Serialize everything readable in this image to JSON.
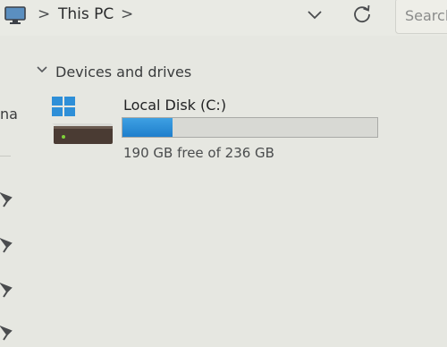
{
  "header": {
    "breadcrumb": {
      "separator": ">",
      "items": [
        "This PC"
      ],
      "trailing": ">"
    },
    "search_placeholder": "Search"
  },
  "nav": {
    "partial_label": "na",
    "pin_count": 4
  },
  "main": {
    "group": {
      "title": "Devices and drives",
      "drives": [
        {
          "name": "Local Disk (C:)",
          "free_text": "190 GB free of 236 GB",
          "used_fraction": 0.195,
          "bar_color": "#2a8ad6"
        }
      ]
    }
  },
  "colors": {
    "background": "#e6e7e1",
    "windows_logo": "#2e8fd8",
    "drive_body": "#4a3b33",
    "drive_led": "#7fd23a"
  },
  "icons": {
    "monitor": "monitor-icon",
    "dropdown": "chevron-down-icon",
    "refresh": "refresh-icon",
    "group_toggle": "chevron-down-icon",
    "drive": "hard-drive-icon",
    "pin": "pin-icon"
  }
}
